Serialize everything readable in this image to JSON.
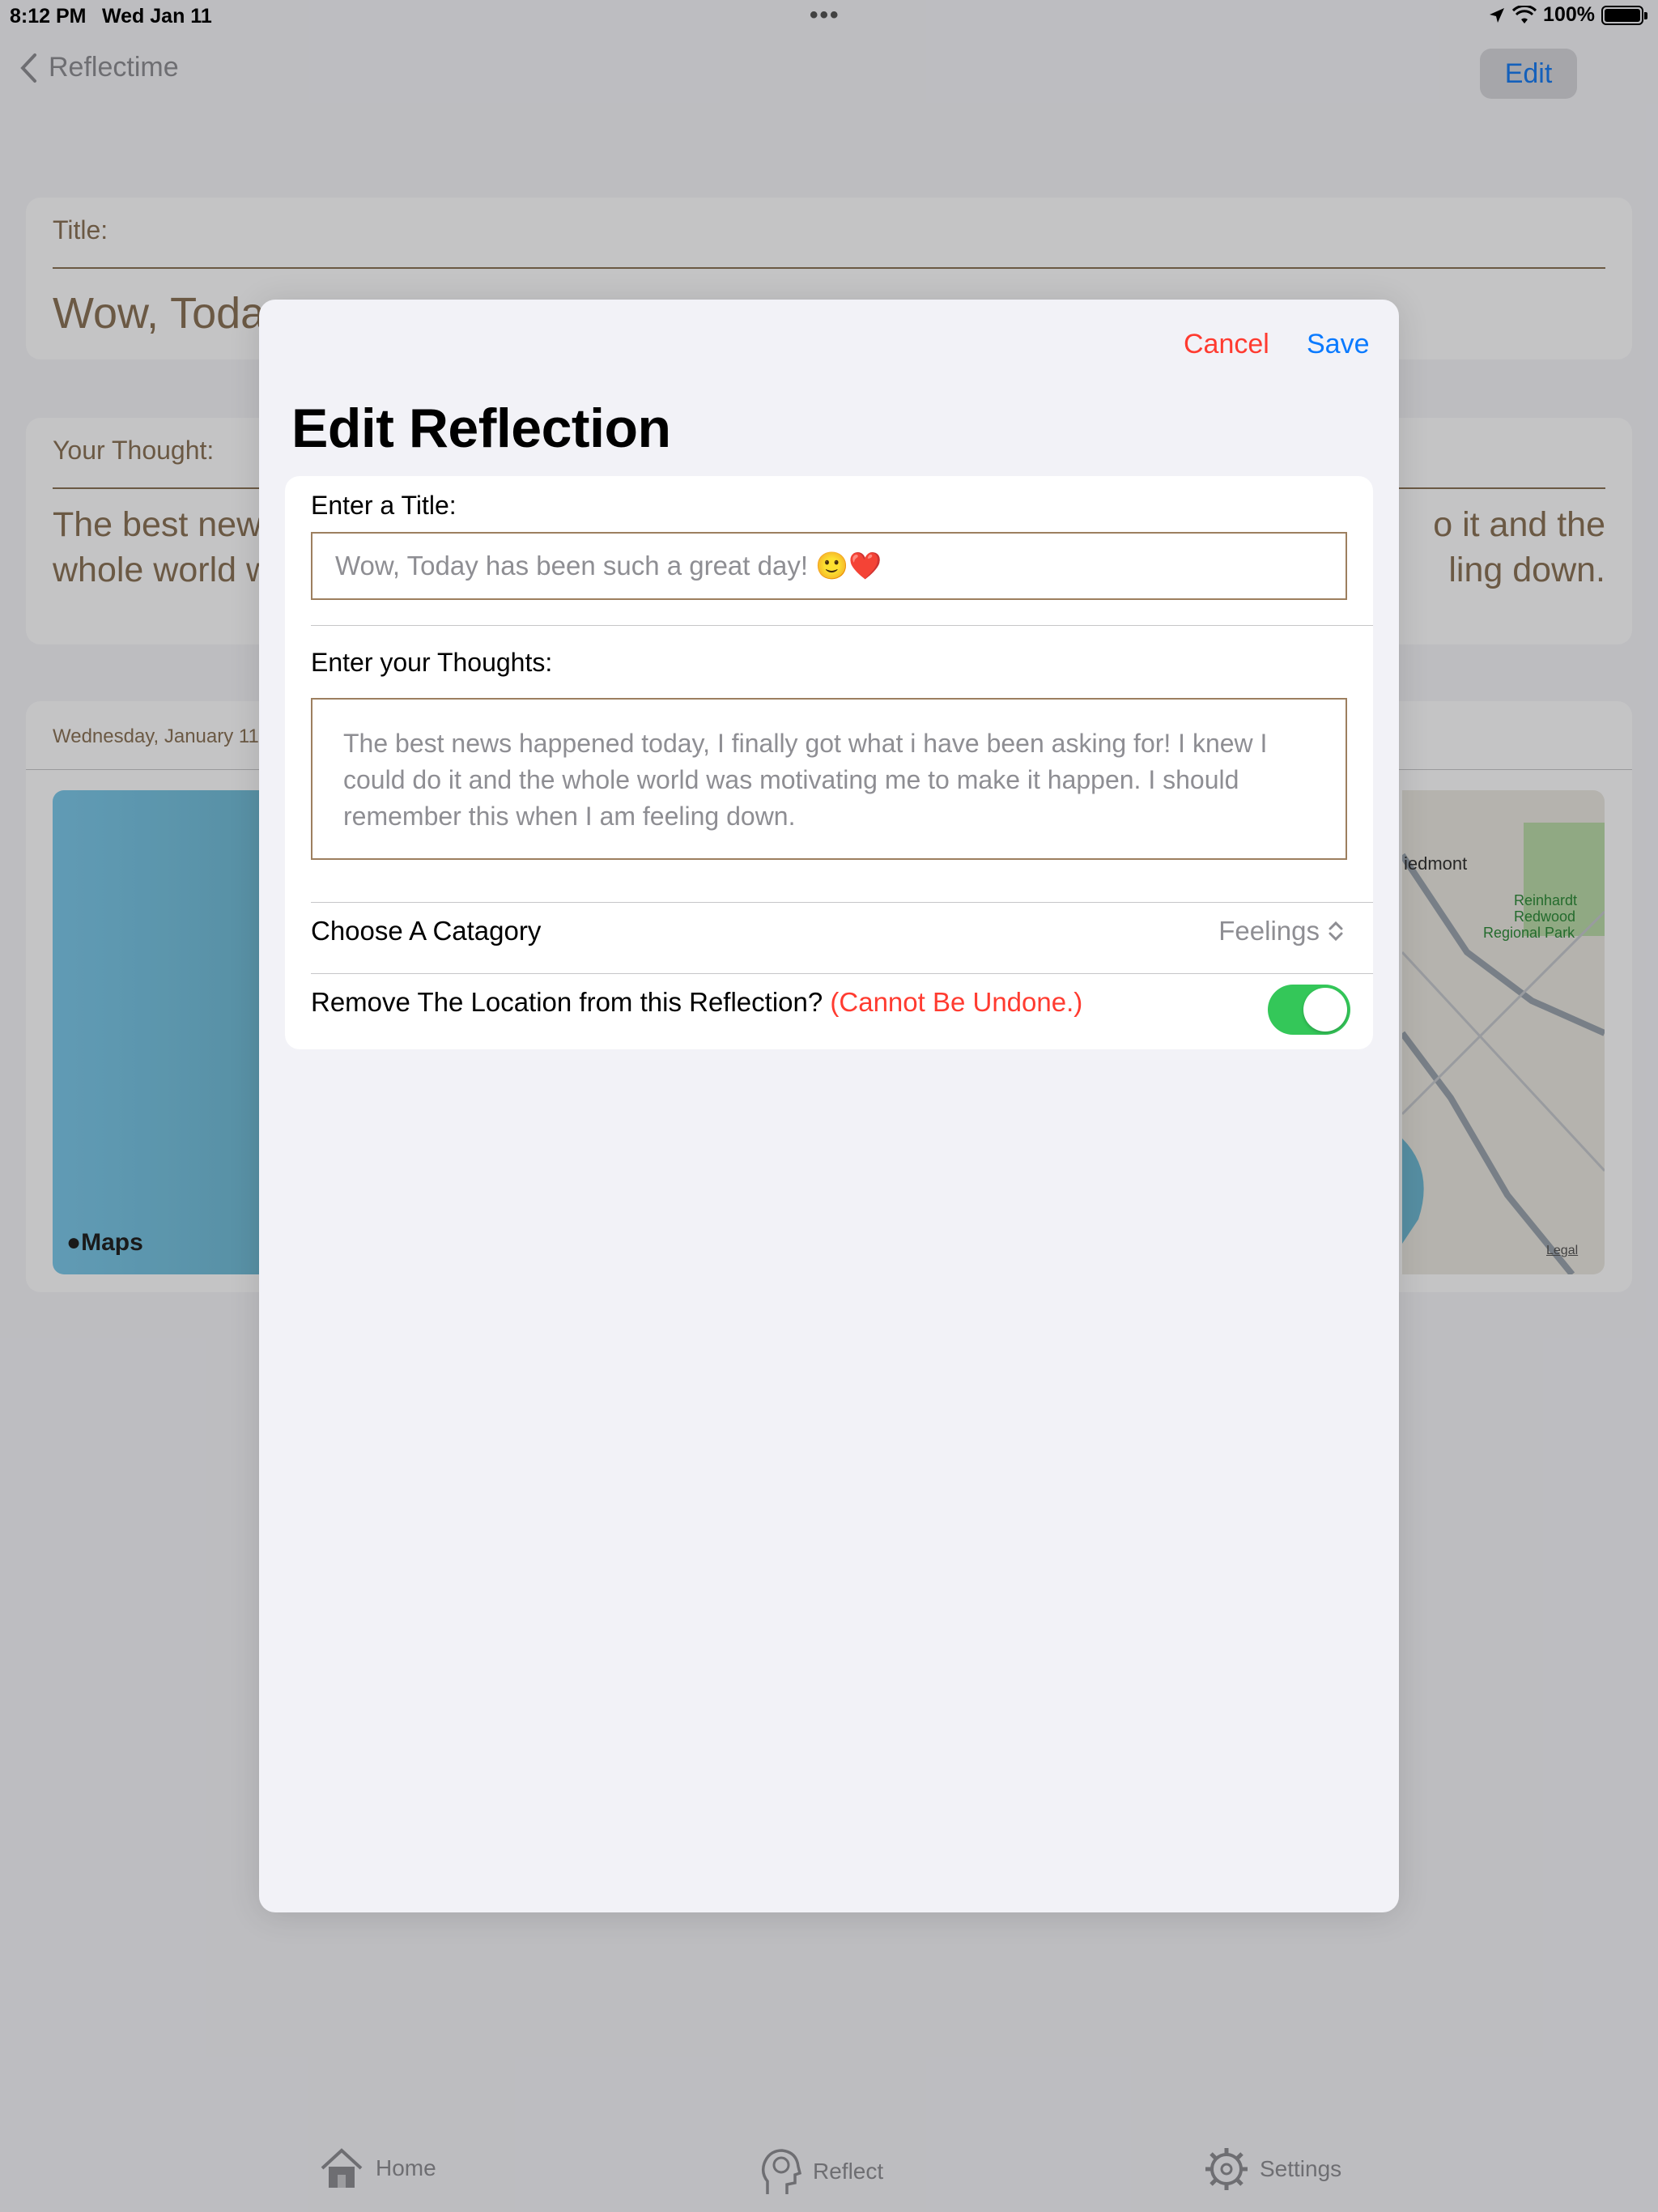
{
  "status_bar": {
    "time": "8:12 PM",
    "date": "Wed Jan 11",
    "battery": "100%",
    "battery_level": 1.0
  },
  "nav": {
    "back_label": "Reflectime",
    "edit_label": "Edit"
  },
  "background": {
    "title_label": "Title:",
    "title_value": "Wow, Toda",
    "thought_label": "Your Thought:",
    "thought_left_1": "The best new",
    "thought_left_2": "whole world w",
    "thought_right_1": "o it and the",
    "thought_right_2": "ling down.",
    "date": "Wednesday, January 11",
    "maps_label": "Maps",
    "map_place_1": "iedmont",
    "map_place_2": "Reinhardt",
    "map_place_3": "Redwood",
    "map_place_4": "Regional Park",
    "map_legal": "Legal"
  },
  "tabs": [
    {
      "label": "Home",
      "icon": "house-icon"
    },
    {
      "label": "Reflect",
      "icon": "brain-head-icon"
    },
    {
      "label": "Settings",
      "icon": "gear-icon"
    }
  ],
  "sheet": {
    "cancel_label": "Cancel",
    "save_label": "Save",
    "title": "Edit Reflection",
    "title_field_label": "Enter a Title:",
    "title_field_value": "Wow, Today has been such a great day! 🙂❤️",
    "thoughts_field_label": "Enter your Thoughts:",
    "thoughts_field_value": "The best news happened today, I finally got what i have been asking for! I knew I could do it and the whole world was motivating me to make it happen. I should remember this when I am feeling down.",
    "category_label": "Choose A Catagory",
    "category_value": "Feelings",
    "remove_location_label": "Remove The Location from this Reflection?",
    "remove_location_warning": "(Cannot Be Undone.)",
    "remove_location_enabled": true
  },
  "colors": {
    "accent_blue": "#0a7aff",
    "destructive_red": "#ff3b30",
    "toggle_green": "#34c759",
    "brown_text": "#8a7258"
  }
}
